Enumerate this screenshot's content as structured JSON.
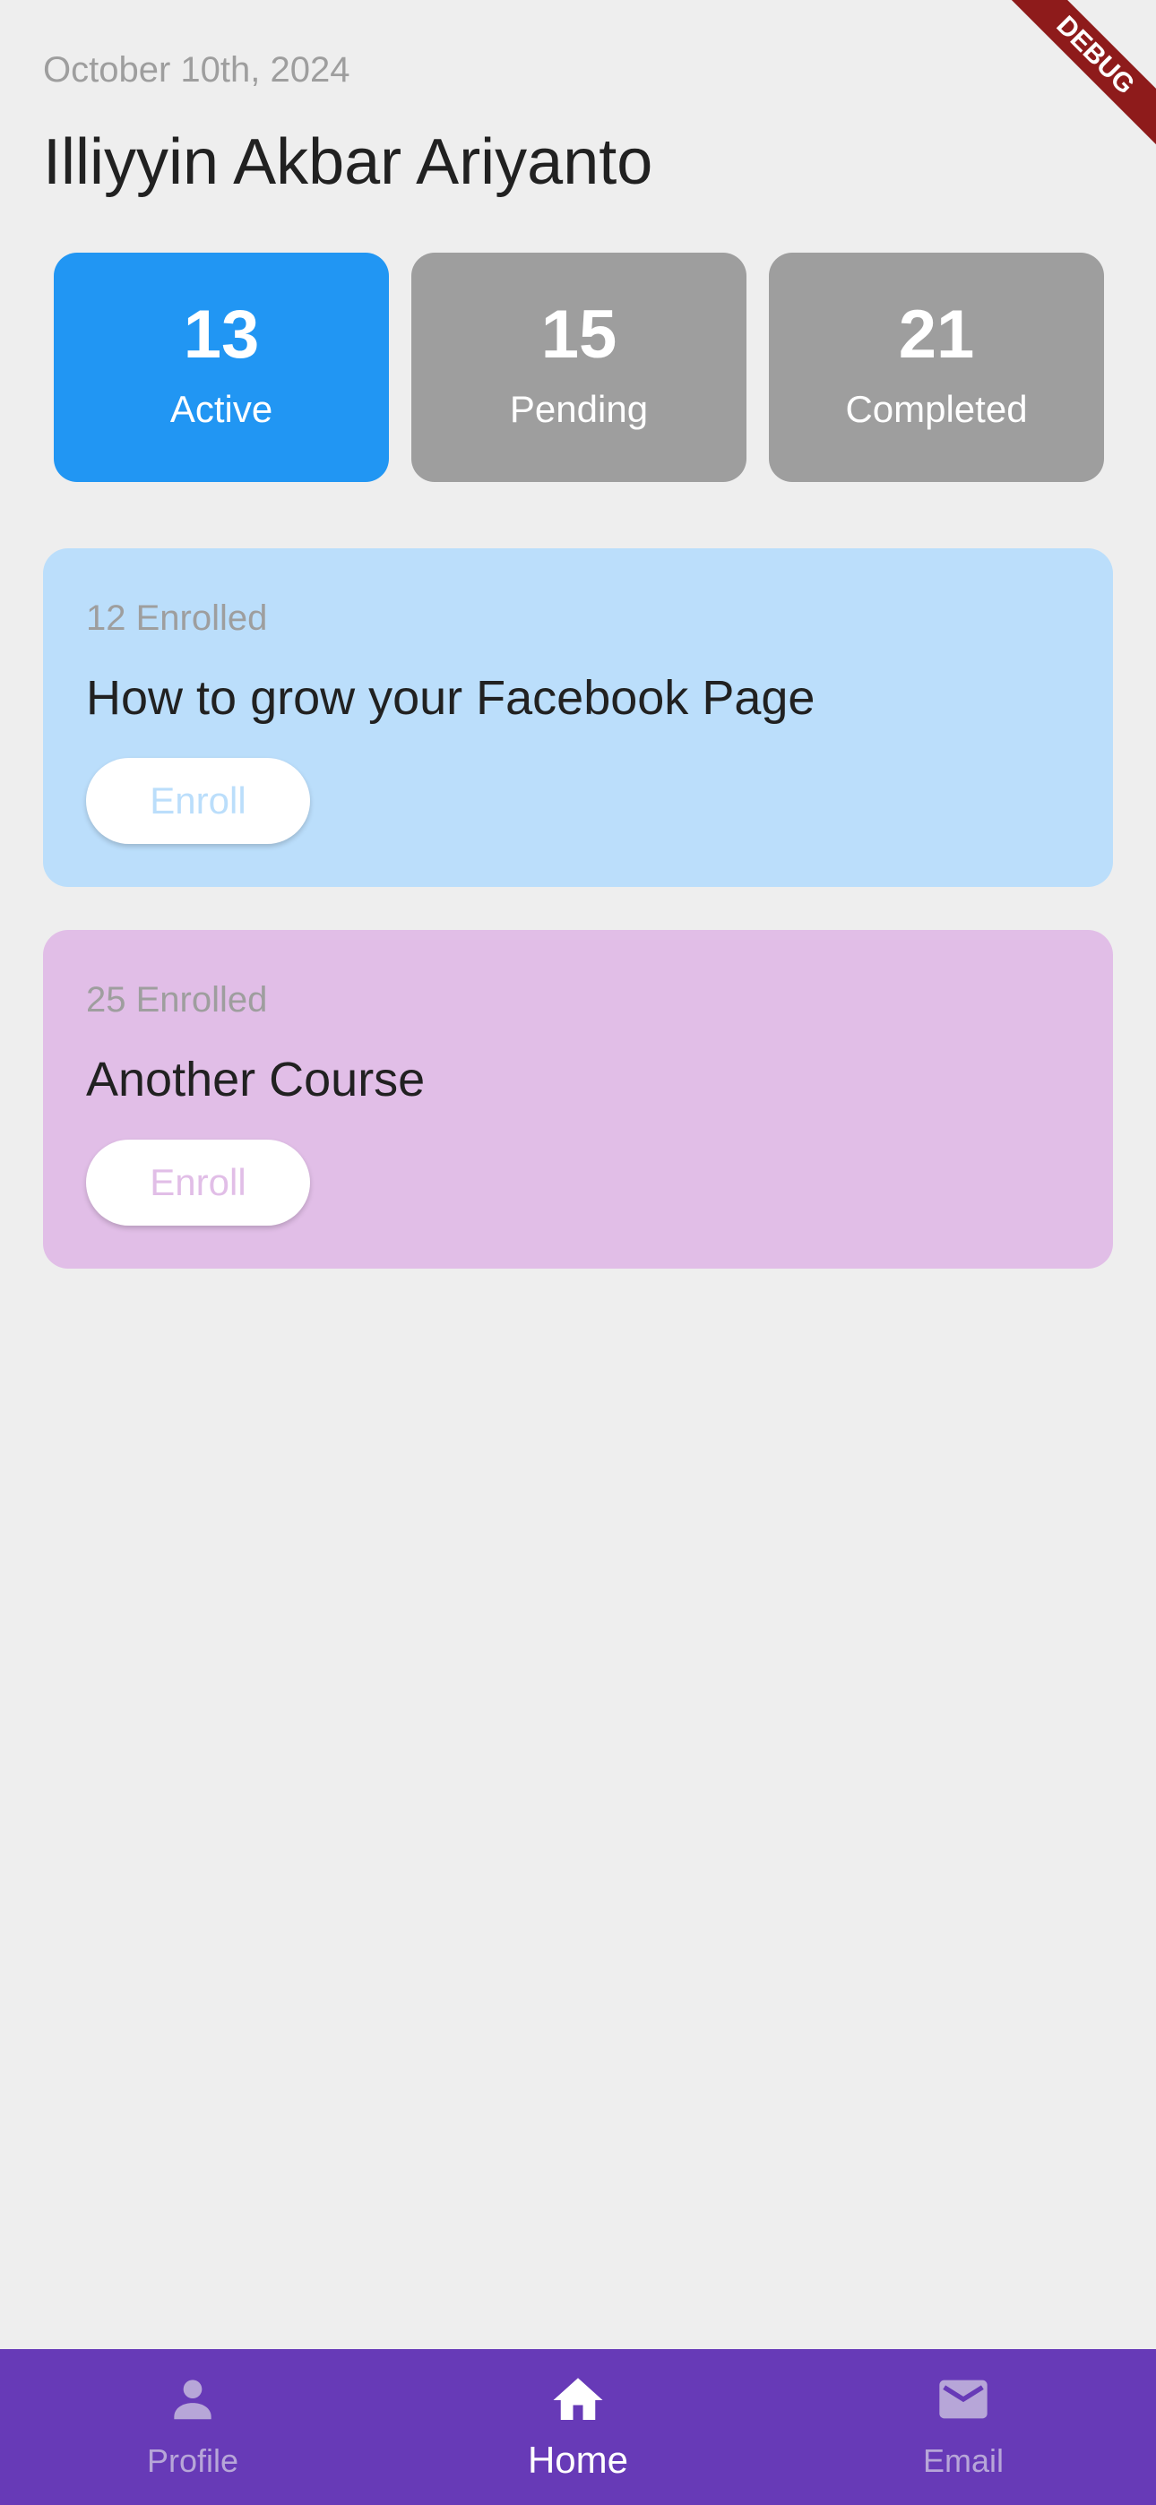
{
  "header": {
    "date": "October 10th, 2024",
    "name": "Illiyyin Akbar Ariyanto"
  },
  "stats": [
    {
      "value": "13",
      "label": "Active",
      "color": "#2196F3"
    },
    {
      "value": "15",
      "label": "Pending",
      "color": "#9E9E9E"
    },
    {
      "value": "21",
      "label": "Completed",
      "color": "#9E9E9E"
    }
  ],
  "courses": [
    {
      "enrolled": "12 Enrolled",
      "title": "How to grow your Facebook Page",
      "button": "Enroll",
      "color": "#BBDEFB",
      "button_text_color": "#BBDEFB"
    },
    {
      "enrolled": "25 Enrolled",
      "title": "Another Course",
      "button": "Enroll",
      "color": "#E1BEE7",
      "button_text_color": "#E1BEE7"
    }
  ],
  "debug_banner": "DEBUG",
  "bottom_nav": {
    "items": [
      {
        "label": "Profile",
        "icon": "person-icon"
      },
      {
        "label": "Home",
        "icon": "home-icon",
        "selected": true
      },
      {
        "label": "Email",
        "icon": "mail-icon"
      }
    ],
    "color": "#673AB7"
  }
}
